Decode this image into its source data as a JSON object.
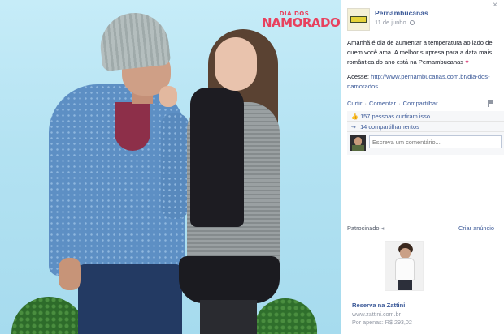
{
  "photo": {
    "campaign_logo_small": "DIA DOS",
    "campaign_logo_big": "NAMORADOS",
    "campaign_logo_color": "#e8415e",
    "background_color": "#b3e2f2"
  },
  "post": {
    "close_icon": "×",
    "page_name": "Pernambucanas",
    "timestamp": "11 de junho",
    "text": "Amanhã é dia de aumentar a temperatura ao lado de quem você ama. A melhor surpresa para a data mais romântica do ano está na Pernambucanas",
    "heart": "♥",
    "link_label": "Acesse:",
    "link_url": "http://www.pernambucanas.com.br/dia-dos-namorados"
  },
  "actions": {
    "like": "Curtir",
    "comment": "Comentar",
    "share": "Compartilhar",
    "separator": "·"
  },
  "ufi": {
    "likes_count": "157",
    "likes_text": "pessoas curtiram isso.",
    "shares_text": "14 compartilhamentos",
    "comment_placeholder": "Escreva um comentário..."
  },
  "ads": {
    "sponsored_label": "Patrocinado",
    "create_ad_label": "Criar anúncio",
    "ad_title": "Reserva na Zattini",
    "ad_url": "www.zattini.com.br",
    "ad_price": "Por apenas: R$ 293,02"
  },
  "colors": {
    "link_blue": "#3b5998",
    "muted_gray": "#9197a3",
    "ufi_background": "#f6f7f9"
  }
}
